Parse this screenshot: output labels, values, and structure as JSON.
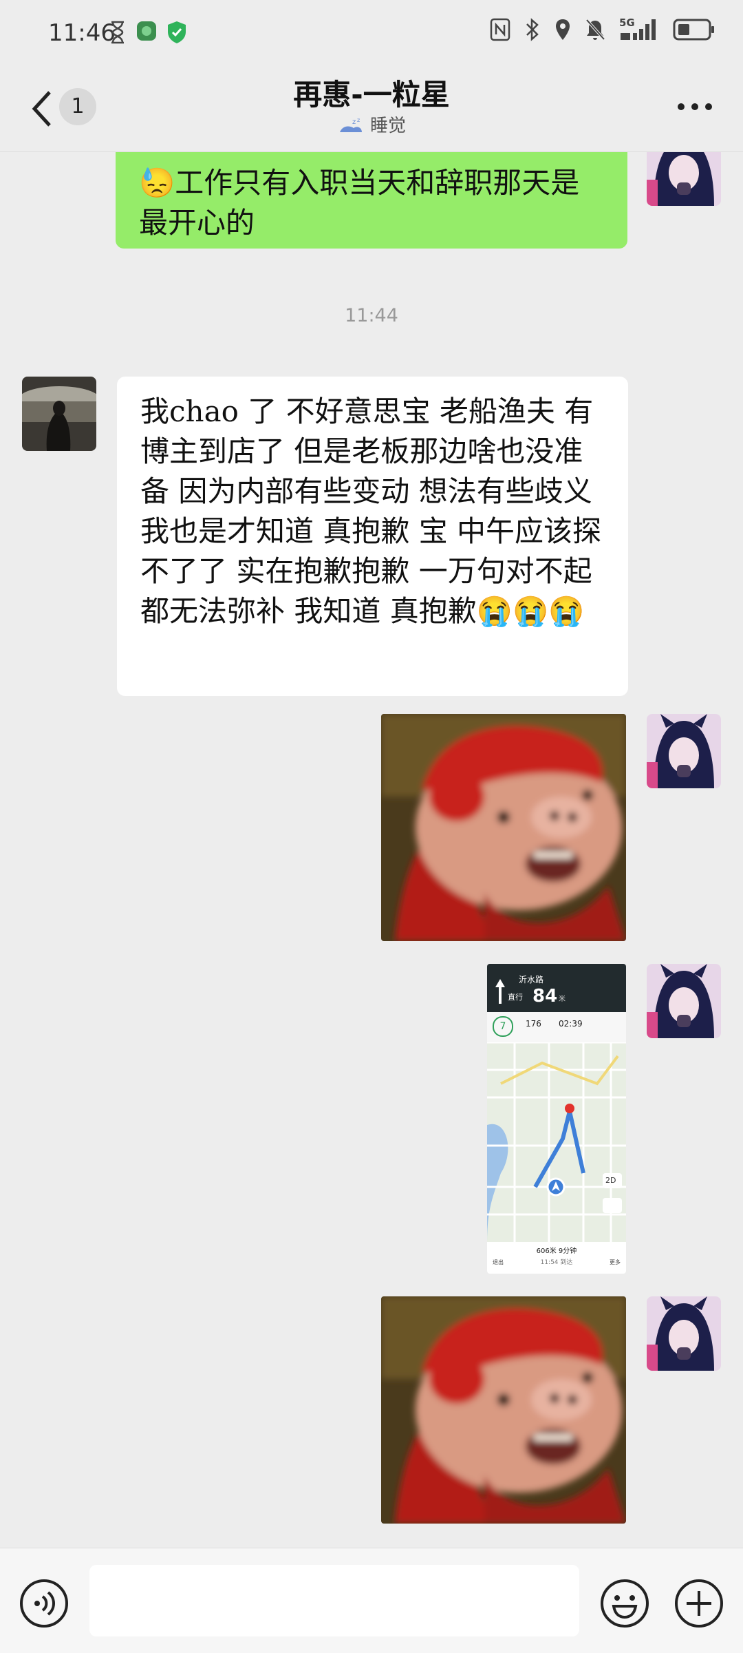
{
  "status_bar": {
    "time": "11:46",
    "signal_label": "5G"
  },
  "header": {
    "unread_count": "1",
    "title": "再惠-一粒星",
    "subtitle": "睡觉"
  },
  "messages": [
    {
      "sender": "me",
      "type": "text",
      "text": "😓工作只有入职当天和辞职那天是最开心的"
    },
    {
      "type": "timestamp",
      "text": "11:44"
    },
    {
      "sender": "other",
      "type": "text",
      "text": "我chao 了  不好意思宝  老船渔夫 有博主到店了 但是老板那边啥也没准备 因为内部有些变动 想法有些歧义  我也是才知道 真抱歉  宝 中午应该探不了了 实在抱歉抱歉 一万句对不起都无法弥补 我知道 真抱歉😭😭😭"
    },
    {
      "sender": "me",
      "type": "sticker",
      "sticker": "red-pig-sticker"
    },
    {
      "sender": "me",
      "type": "image",
      "image": "navigation-screenshot"
    },
    {
      "sender": "me",
      "type": "sticker",
      "sticker": "red-pig-sticker"
    }
  ],
  "nav_screenshot": {
    "road": "沂水路",
    "direct_label": "直行",
    "distance": "84",
    "distance_unit": "米",
    "speed": "7",
    "stat_a": "176",
    "stat_b": "02:39",
    "view_mode": "2D",
    "summary": "606米 9分钟",
    "eta": "11:54 到达",
    "exit_label": "退出",
    "more_label": "更多"
  },
  "input": {
    "placeholder": ""
  },
  "colors": {
    "background": "#ededed",
    "bubble_me": "#95ec69",
    "bubble_other": "#ffffff"
  }
}
